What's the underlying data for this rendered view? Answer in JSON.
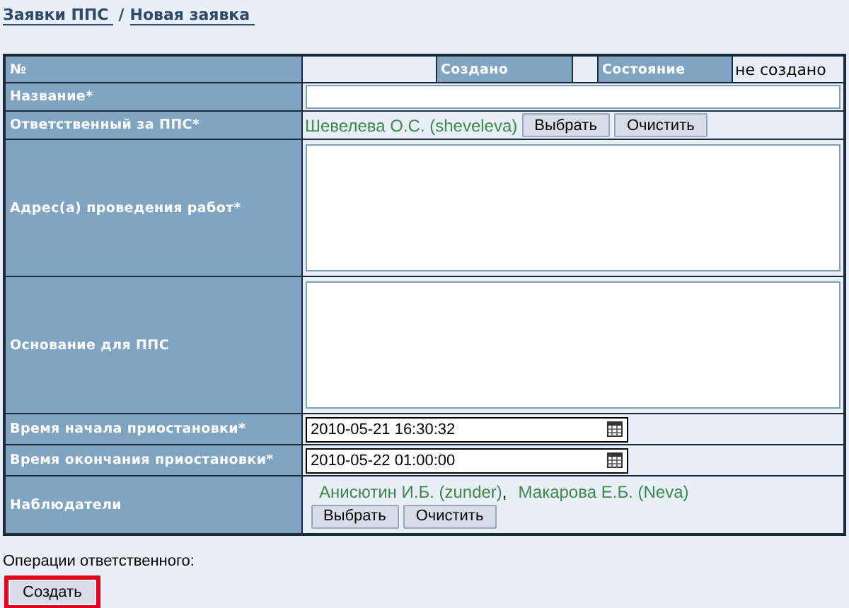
{
  "breadcrumbs": [
    {
      "label": "Заявки ППС"
    },
    {
      "label": "Новая заявка"
    }
  ],
  "breadcrumb_separator": "/",
  "header": {
    "number_label": "№",
    "created_label": "Создано",
    "state_label": "Состояние",
    "state_value": "не создано"
  },
  "rows": [
    {
      "kind": "text",
      "label": "Название*"
    },
    {
      "kind": "people",
      "label": "Ответственный за ППС*",
      "people": [
        "Шевелева О.С. (sheveleva)"
      ],
      "buttons": [
        "Выбрать",
        "Очистить"
      ]
    },
    {
      "kind": "textarea",
      "label": "Адрес(а) проведения работ*"
    },
    {
      "kind": "textarea",
      "label": "Основание для ППС"
    },
    {
      "kind": "datetime",
      "label": "Время начала приостановки*",
      "value": "2010-05-21 16:30:32"
    },
    {
      "kind": "datetime",
      "label": "Время окончания приостановки*",
      "value": "2010-05-22 01:00:00"
    },
    {
      "kind": "people_list",
      "label": "Наблюдатели",
      "people": [
        "Анисютин И.Б. (zunder)",
        "Макарова Е.Б. (Neva)"
      ],
      "separator": ",",
      "buttons": [
        "Выбрать",
        "Очистить"
      ]
    }
  ],
  "operations": {
    "label": "Операции ответственного:",
    "buttons": [
      {
        "label": "Создать",
        "highlighted": true
      }
    ]
  }
}
